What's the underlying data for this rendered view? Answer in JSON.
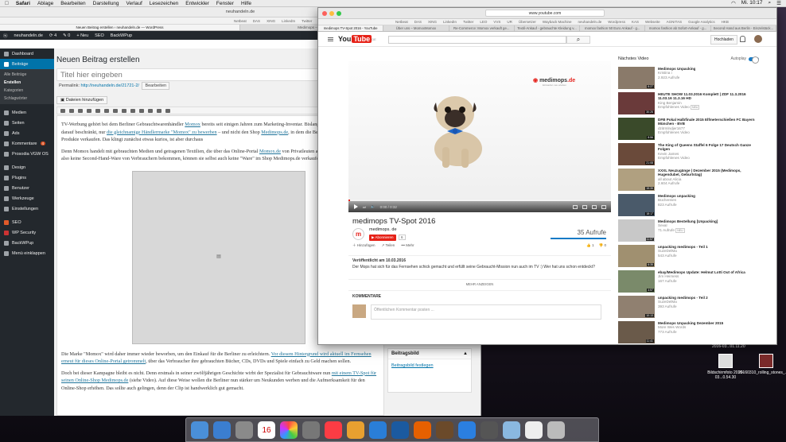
{
  "menubar": {
    "items": [
      "Safari",
      "Ablage",
      "Bearbeiten",
      "Darstellung",
      "Verlauf",
      "Lesezeichen",
      "Entwickler",
      "Fenster",
      "Hilfe"
    ],
    "time": "Mi. 10:17"
  },
  "win1": {
    "url": "neuhandeln.de",
    "bookmarks": [
      "Netbeat",
      "DAS",
      "XING",
      "LinkedIn",
      "Twitter",
      "LEO",
      "VVS",
      "UR",
      "Übersetzer",
      "Wayback Machine",
      "neuhandeln.de",
      "Wordpress",
      "KAS"
    ],
    "tabs": [
      "Neuen Beitrag erstellen ‹ neuhandeln.de — WordPress",
      "Medimops – Wir kaufen und verkaufen gebrauchte Bücher, CDs, DVDs, Spiele"
    ],
    "adminbar": {
      "site": "neuhandeln.de",
      "comments": "4",
      "updates": "0",
      "new": "Neu",
      "seo": "SEO",
      "backup": "BackWPup"
    },
    "sidebar": {
      "dashboard": "Dashboard",
      "posts": "Beiträge",
      "sub": [
        "Alle Beiträge",
        "Erstellen",
        "Kategorien",
        "Schlagwörter"
      ],
      "items": [
        "Medien",
        "Seiten",
        "Ads",
        "Kommentare",
        "Prosodia VGW OS",
        "Design",
        "Plugins",
        "Benutzer",
        "Werkzeuge",
        "Einstellungen",
        "SEO",
        "WP Security",
        "BackWPup",
        "Menü einklappen"
      ],
      "comments_badge": "4"
    },
    "editor": {
      "heading": "Neuen Beitrag erstellen",
      "title_placeholder": "Titel hier eingeben",
      "permalink_label": "Permalink:",
      "permalink": "http://neuhandeln.de/21721-2/",
      "permalink_btn": "Bearbeiten",
      "media_btn": "Dateien hinzufügen",
      "p1a": "TV-Werbung gehört bei dem Berliner Gebrauchtwarenhändler ",
      "p1link": "Momox",
      "p1b": " bereits seit einigen Jahren zum Marketing-Inventar. Bislang hat sich bei TV-Spots aber darauf beschränkt, nur ",
      "p1link2": "die gleichnamige Händlermarke \"Momox\" zu bewerben",
      "p1c": " – und nicht den Shop ",
      "p1link3": "Medimops.de",
      "p1d": ", in dem die Berliner ihre gebrauchten Produkte verkaufen. Das klingt zunächst etwas kurios, ist aber durchaus",
      "p2a": "Denn Momox handelt mit gebrauchten Medien und getragenen Textilien, die über das Online-Portal ",
      "p2link": "Momox.de",
      "p2b": " von Privatleuten angekauft werden. Der Berliner also keine Second-Hand-Ware von Verbrauchern bekommen, können sie selbst auch keine \"Ware\" im Shop Medimops.de verkaufen.",
      "img_icon": "▤",
      "p3a": "Die Marke \"Momox\" wird daher immer wieder beworben, um den Einkauf für die Berliner zu erleichtern. ",
      "p3link": "Vor diesem Hintergrund wird aktuell im Fernsehen erneut für dieses Online-Portal getrommelt",
      "p3b": ", über das Verbraucher ihre gebrauchten Bücher, CDs, DVDs und Spiele einfach zu Geld machen sollen.",
      "p4a": "Doch bei dieser Kampagne bleibt es nicht. Denn erstmals in seiner zwölfjährigen Geschichte wirbt der Spezialist für Gebrauchtware nun ",
      "p4link": "mit einem TV-Spot für seinen Online-Shop Medimops.de",
      "p4b": " (siehe Video). Auf diese Weise wollen die Berliner nun stärker um Neukunden werben und die Aufmerksamkeit für den Online-Shop erhöhen. Das sollte auch gelingen, denn der Clip ist handwerklich gut gemacht."
    },
    "metabox": {
      "title": "Beitragsbild",
      "link": "Beitragsbild festlegen",
      "arrow": "▲"
    }
  },
  "win2": {
    "tab_title": "medimops TV-Spot 2016 - YouTube",
    "url": "www.youtube.com",
    "bookmarks": [
      "Netbeat",
      "DAS",
      "XING",
      "LinkedIn",
      "Twitter",
      "LEO",
      "VVS",
      "UR",
      "Übersetzer",
      "Wayback Machine",
      "neuhandeln.de",
      "Wordpress",
      "KAS",
      "Webseite",
      "AGNITAS",
      "Google Analytics",
      "HKB"
    ],
    "tabs": [
      "medimops TV-Spot 2016 - YouTube",
      "Über uns – MomoxMomox",
      "Re-Commerce: Momox verkauft ge...",
      "Textil-Ankauf - gebrauchte Kleidung v...",
      "momox fashion 50 Euro Ankauf - g...",
      "momox fashion ab Sofort-Ankauf - g...",
      "Second Hand aus Berlin - Einzelstück..."
    ],
    "header": {
      "upload": "Hochladen",
      "logo_you": "You",
      "logo_tube": "Tube",
      "logo_sup": "DE"
    },
    "player": {
      "logo_a": "medimops",
      "logo_b": ".de",
      "logo_sub": "Einkaufen neu erleben",
      "time": "0:00 / 0:32"
    },
    "video": {
      "title": "medimops TV-Spot 2016",
      "channel": "medimops. de",
      "channel_initial": "m",
      "subscribe": "Abonnieren",
      "subcount": "6",
      "views": "35 Aufrufe",
      "add": "Hinzufügen",
      "share": "Teilen",
      "more": "Mehr",
      "likes": "1",
      "dislikes": "0"
    },
    "description": {
      "published": "Veröffentlicht am 10.03.2016",
      "text": "Der Mops hat sich für das Fernsehen schick gemacht und erfüllt seine Gebraucht-Mission nun auch im TV :) Wer hat uns schon entdeckt?",
      "more": "MEHR ANZEIGEN"
    },
    "comments": {
      "label": "KOMMENTARE",
      "placeholder": "Öffentlichen Kommentar posten ..."
    },
    "sidebar": {
      "next_label": "Nächstes Video",
      "autoplay": "Autoplay",
      "videos": [
        {
          "title": "Medimops Unpacking",
          "channel": "Kristina i",
          "views": "2.923 Aufrufe",
          "dur": "8:27",
          "color": "#8a7a6a"
        },
        {
          "title": "HEUTE SHOW 11.03.2016 Komplett | ZDF 11.3.2016 11.03.16 11.3.16 HD",
          "channel": "King Benjamin",
          "views": "Empfohlenes Video",
          "neu": "NEU",
          "dur": "30:25",
          "color": "#6a3a3a"
        },
        {
          "title": "DFB Pokal Halbfinale 2015 Elfmeterschießen FC Bayern München - BVB",
          "channel": "dzitrmlndjer1677",
          "views": "Empfohlenes Video",
          "dur": "8:56",
          "color": "#3a4a2a"
        },
        {
          "title": "The King of Queens Staffel 6 Folge 17 Deutsch Ganze Folgen",
          "channel": "Kevin James",
          "views": "Empfohlenes Video",
          "dur": "21:08",
          "color": "#6a4a3a"
        },
        {
          "title": "XXXL Neuzugänge | Dezember 2015 (Medimops, Hugendubel, Geburtstag)",
          "channel": "all about Alicia",
          "views": "2.604 Aufrufe",
          "dur": "15:39",
          "color": "#b0a080"
        },
        {
          "title": "Medimops unpacking",
          "channel": "Büchereien",
          "views": "823 Aufrufe",
          "dur": "18:17",
          "color": "#4a5a6a"
        },
        {
          "title": "Medimops Bestellung [Unpacking]",
          "channel": "Seval",
          "views": "71 Aufrufe",
          "neu": "NEU",
          "dur": "11:57",
          "color": "#c8c8c8"
        },
        {
          "title": "unpacking medimops - Teil 1",
          "channel": "SuzeDelMa",
          "views": "543 Aufrufe",
          "dur": "6:35",
          "color": "#a09070"
        },
        {
          "title": "ebay/Medimops Update: Helmut Lotti Out of Africa",
          "channel": "Jim Heimess",
          "views": "167 Aufrufe",
          "dur": "4:57",
          "color": "#7a8a6a"
        },
        {
          "title": "unpacking medimops - Teil 2",
          "channel": "SuzeDelMa",
          "views": "393 Aufrufe",
          "dur": "10:13",
          "color": "#908070"
        },
        {
          "title": "Medimops Unpacking Dezember 2015",
          "channel": "More Wes Words",
          "views": "773 Aufrufe",
          "dur": "11:41",
          "color": "#6a5a4a"
        }
      ]
    }
  },
  "desktop": {
    "file1": "Bildschirmfoto 2016-03...0.54.30",
    "file2": "20160310_rolling_stones_...1_800.jpg",
    "file3": "2016-03...01.11.20",
    "calendar_day": "16"
  }
}
